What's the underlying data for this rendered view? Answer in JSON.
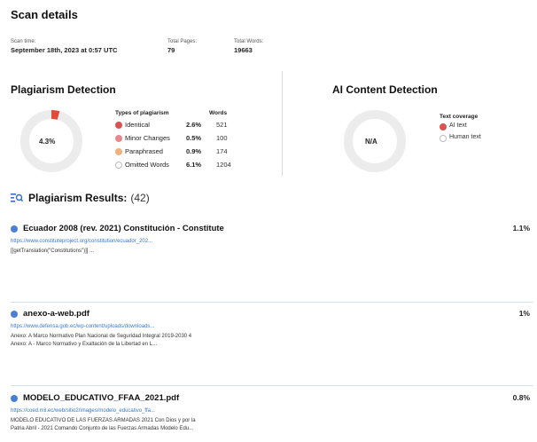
{
  "scan": {
    "title": "Scan details",
    "time_label": "Scan time:",
    "time_value": "September 18th, 2023 at 0:57 UTC",
    "pages_label": "Total Pages:",
    "pages_value": "79",
    "words_label": "Total Words:",
    "words_value": "19663"
  },
  "plagiarism": {
    "title": "Plagiarism Detection",
    "total_percent_label": "4.3%",
    "total_percent": 4.3,
    "types_header": "Types of plagiarism",
    "words_header": "Words",
    "types": [
      {
        "name": "Identical",
        "percent": "2.6%",
        "words": "521",
        "color": "#d9534f"
      },
      {
        "name": "Minor Changes",
        "percent": "0.5%",
        "words": "100",
        "color": "#e8878a"
      },
      {
        "name": "Paraphrased",
        "percent": "0.9%",
        "words": "174",
        "color": "#f0b27a"
      },
      {
        "name": "Omitted Words",
        "percent": "6.1%",
        "words": "1204",
        "color": "#ffffff"
      }
    ]
  },
  "ai": {
    "title": "AI Content Detection",
    "value_label": "N/A",
    "coverage_header": "Text coverage",
    "legend": [
      {
        "name": "AI text",
        "color": "#d9534f"
      },
      {
        "name": "Human text",
        "color": "#ffffff"
      }
    ]
  },
  "results": {
    "title": "Plagiarism Results:",
    "count": "(42)",
    "items": [
      {
        "title": "Ecuador 2008 (rev. 2021) Constitución - Constitute",
        "percent": "1.1%",
        "url": "https://www.constituteproject.org/constitution/ecuador_202...",
        "snippet1": "[[getTranslation(\"Constitutions\")]] ...",
        "snippet2": ""
      },
      {
        "title": "anexo-a-web.pdf",
        "percent": "1%",
        "url": "https://www.defensa.gob.ec/wp-content/uploads/downloads...",
        "snippet1": "Anexo: A Marco Normativo Plan Nacional de Seguridad Integral 2019-2030 4",
        "snippet2": "Anexo: A - Marco Normativo y Exaltación de la Libertad en L..."
      },
      {
        "title": "MODELO_EDUCATIVO_FFAA_2021.pdf",
        "percent": "0.8%",
        "url": "https://coed.mil.ec/web/sitio2/images/modelo_educativo_ffa...",
        "snippet1": "MODELO EDUCATIVO DE LAS FUERZAS ARMADAS 2021 Con Dios y por la",
        "snippet2": "Patria Abril - 2021 Comando Conjunto de las Fuerzas Armadas Modelo Edu..."
      }
    ]
  }
}
